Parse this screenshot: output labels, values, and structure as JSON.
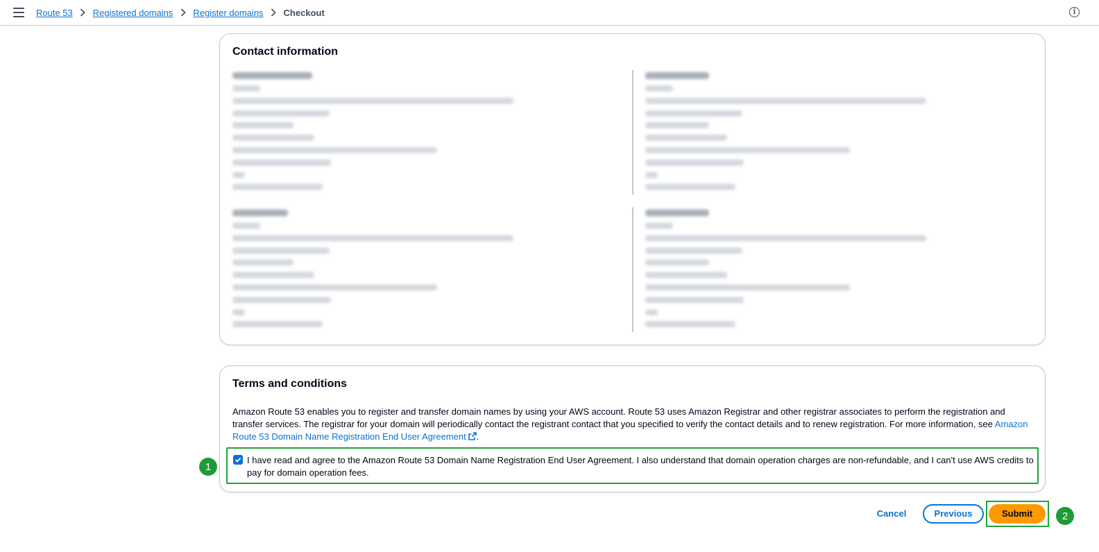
{
  "breadcrumb": {
    "items": [
      "Route 53",
      "Registered domains",
      "Register domains"
    ],
    "current": "Checkout"
  },
  "icons": {
    "menu": "hamburger-menu-icon",
    "separator": "chevron-right-icon",
    "info": "info-icon",
    "external": "external-link-icon",
    "check": "checkmark-icon"
  },
  "contact": {
    "title": "Contact information"
  },
  "terms": {
    "title": "Terms and conditions",
    "body": "Amazon Route 53 enables you to register and transfer domain names by using your AWS account. Route 53 uses Amazon Registrar and other registrar associates to perform the registration and transfer services. The registrar for your domain will periodically contact the registrant contact that you specified to verify the contact details and to renew registration. For more information, see ",
    "link": "Amazon Route 53 Domain Name Registration End User Agreement",
    "after_link": ".",
    "agree_label": "I have read and agree to the Amazon Route 53 Domain Name Registration End User Agreement. I also understand that domain operation charges are non-refundable, and I can't use AWS credits to pay for domain operation fees.",
    "agreed": true
  },
  "steps": {
    "step1": "1",
    "step2": "2"
  },
  "actions": {
    "cancel": "Cancel",
    "previous": "Previous",
    "submit": "Submit"
  },
  "colors": {
    "link": "#0972d3",
    "primary_button": "#ff9900",
    "highlight": "#1ea339"
  }
}
